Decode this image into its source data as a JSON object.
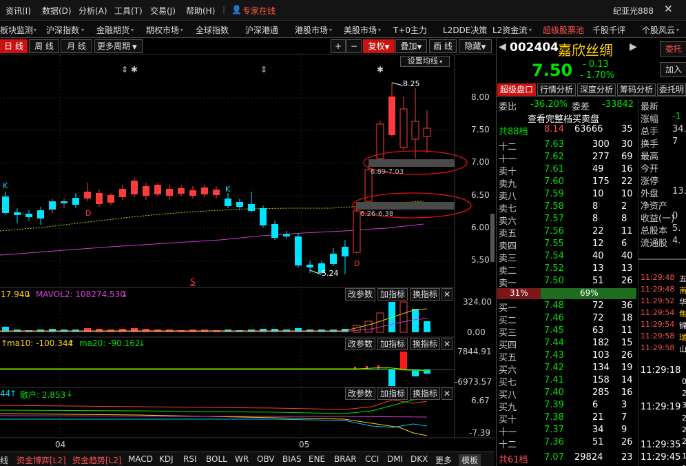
{
  "menu": {
    "items": [
      "资讯(I)",
      "数据(D)",
      "分析(A)",
      "工具(T)",
      "交易(J)",
      "帮助(H)"
    ],
    "expert": "专家在线",
    "user": "纪亚光888"
  },
  "nav": {
    "items": [
      "板块监测",
      "沪深指数",
      "金融期货",
      "期权市场",
      "全球指数",
      "沪深港通",
      "港股市场",
      "美股市场",
      "T+0主力",
      "L2DDE决策",
      "L2资金流",
      "超级股票池",
      "千股千评",
      "个股风云"
    ]
  },
  "toolbar": {
    "periods": [
      "日 线",
      "周 线",
      "月 线",
      "更多周期"
    ],
    "plus": "+",
    "minus": "−",
    "fuquan": "复权",
    "overlay": "叠加",
    "drawline": "画 线",
    "hide": "隐藏"
  },
  "chart_main": {
    "setting": "设置均线",
    "y_ticks": [
      "8.00",
      "7.50",
      "7.00",
      "6.50",
      "6.00",
      "5.50"
    ],
    "high_label": "8.25",
    "low_label": "5.24",
    "box1": "6.89-7.03",
    "box2": "6.26-6.38",
    "markers": {
      "k": "K",
      "d": "D",
      "s": "S"
    }
  },
  "vol_panel": {
    "ma1": "17.940",
    "ma2": "MAVOL2: 108274.530",
    "y_top": "324.00",
    "y_bottom": "0.00"
  },
  "macd_panel": {
    "ma10": "ma10: -100.344",
    "ma20": "ma20: -90.162",
    "y_top": "7844.91",
    "y_bottom": "-6973.57"
  },
  "retail_panel": {
    "first": "44",
    "retail": "散户: 2.853",
    "y_top": "6.67",
    "y_bottom": "-7.39"
  },
  "panel_buttons": {
    "params": "改参数",
    "add": "加指标",
    "change": "换指标"
  },
  "xaxis": {
    "labels": [
      "04",
      "05"
    ]
  },
  "bottom_tabs": [
    "线",
    "资金博弈[L2]",
    "资金趋势[L2]",
    "MACD",
    "KDJ",
    "RSI",
    "BOLL",
    "WR",
    "OBV",
    "BIAS",
    "ENE",
    "BRAR",
    "CCI",
    "DMI",
    "DKX",
    "更多",
    "模板"
  ],
  "stock": {
    "code": "002404",
    "name": "嘉欣丝绸",
    "price": "7.50",
    "change": "- 0.13",
    "pct": "- 1.70%",
    "entrust": "委托",
    "add": "加入"
  },
  "tabs": [
    "超级盘口",
    "行情分析",
    "深度分析",
    "筹码分析",
    "委托明"
  ],
  "weibi": {
    "label": "委比",
    "value": "-36.20%",
    "label2": "委差",
    "value2": "-33842"
  },
  "full_book": "查看完整档买卖盘",
  "sell_total": {
    "label": "共88档",
    "price": "8.14",
    "vol": "63666",
    "n": "35"
  },
  "asks": [
    {
      "label": "十二",
      "price": "7.63",
      "vol": "300",
      "n": "30"
    },
    {
      "label": "十一",
      "price": "7.62",
      "vol": "277",
      "n": "69"
    },
    {
      "label": "卖十",
      "price": "7.61",
      "vol": "49",
      "n": "16"
    },
    {
      "label": "卖九",
      "price": "7.60",
      "vol": "175",
      "n": "22"
    },
    {
      "label": "卖八",
      "price": "7.59",
      "vol": "10",
      "n": "10"
    },
    {
      "label": "卖七",
      "price": "7.58",
      "vol": "8",
      "n": "2"
    },
    {
      "label": "卖六",
      "price": "7.57",
      "vol": "8",
      "n": "8"
    },
    {
      "label": "卖五",
      "price": "7.56",
      "vol": "22",
      "n": "11"
    },
    {
      "label": "卖四",
      "price": "7.55",
      "vol": "12",
      "n": "6"
    },
    {
      "label": "卖三",
      "price": "7.54",
      "vol": "40",
      "n": "40"
    },
    {
      "label": "卖二",
      "price": "7.52",
      "vol": "13",
      "n": "13"
    },
    {
      "label": "卖一",
      "price": "7.50",
      "vol": "51",
      "n": "26"
    }
  ],
  "ratio": {
    "buy": "31%",
    "sell": "69%"
  },
  "bids": [
    {
      "label": "买一",
      "price": "7.48",
      "vol": "72",
      "n": "36"
    },
    {
      "label": "买二",
      "price": "7.46",
      "vol": "72",
      "n": "18"
    },
    {
      "label": "买三",
      "price": "7.45",
      "vol": "63",
      "n": "11"
    },
    {
      "label": "买四",
      "price": "7.44",
      "vol": "182",
      "n": "15"
    },
    {
      "label": "买五",
      "price": "7.43",
      "vol": "103",
      "n": "26"
    },
    {
      "label": "买六",
      "price": "7.42",
      "vol": "134",
      "n": "19"
    },
    {
      "label": "买七",
      "price": "7.41",
      "vol": "158",
      "n": "14"
    },
    {
      "label": "买八",
      "price": "7.40",
      "vol": "285",
      "n": "16"
    },
    {
      "label": "买九",
      "price": "7.39",
      "vol": "6",
      "n": "3"
    },
    {
      "label": "买十",
      "price": "7.38",
      "vol": "21",
      "n": "7"
    },
    {
      "label": "十一",
      "price": "7.37",
      "vol": "34",
      "n": "9"
    },
    {
      "label": "十二",
      "price": "7.36",
      "vol": "51",
      "n": "26"
    }
  ],
  "buy_total": {
    "label": "共61档",
    "price": "7.07",
    "vol": "29824",
    "n": "23"
  },
  "stats": [
    {
      "label": "最新",
      "value": ""
    },
    {
      "label": "涨幅",
      "value": "-1"
    },
    {
      "label": "总手",
      "value": "34."
    },
    {
      "label": "换手",
      "value": "7"
    },
    {
      "label": "最高",
      "value": ""
    },
    {
      "label": "今开",
      "value": ""
    },
    {
      "label": "涨停",
      "value": ""
    },
    {
      "label": "外盘",
      "value": "13."
    },
    {
      "label": "净资产",
      "value": ""
    },
    {
      "label": "收益(一)",
      "value": "0"
    },
    {
      "label": "总股本",
      "value": "5."
    },
    {
      "label": "流通股",
      "value": "4."
    }
  ],
  "news": [
    {
      "time": "11:29:48",
      "text": "五"
    },
    {
      "time": "11:29:48",
      "text": "南"
    },
    {
      "time": "11:29:52",
      "text": "华"
    },
    {
      "time": "11:29:54",
      "text": "焦"
    },
    {
      "time": "11:29:54",
      "text": "锦"
    },
    {
      "time": "11:29:58",
      "text": "瑞"
    },
    {
      "time": "11:29:58",
      "text": "山"
    }
  ],
  "ticks": [
    {
      "time": "11:29:18",
      "a": "0",
      "b": "2",
      "c": "3"
    },
    {
      "time": "11:29:19",
      "a": "2",
      "b": "2",
      "c": "2"
    },
    {
      "time": "11:29:35",
      "a": "1",
      "b": "",
      "c": ""
    },
    {
      "time": "11:29:45",
      "a": "1",
      "b": "",
      "c": ""
    }
  ],
  "colors": {
    "up": "#ff3b3b",
    "down": "#00e5ff",
    "green": "#00e000",
    "yellow": "#ffd200",
    "orange": "#ff9a00"
  }
}
